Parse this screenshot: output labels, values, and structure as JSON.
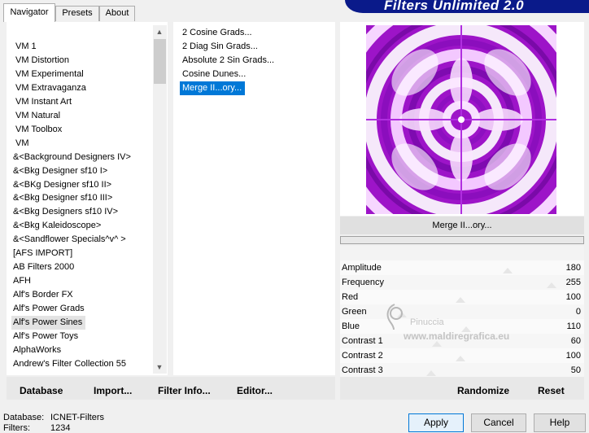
{
  "tabs": [
    "Navigator",
    "Presets",
    "About"
  ],
  "banner_title": "Filters Unlimited 2.0",
  "categories": [
    "VM 1",
    "VM Distortion",
    "VM Experimental",
    "VM Extravaganza",
    "VM Instant Art",
    "VM Natural",
    "VM Toolbox",
    "VM",
    "&<Background Designers IV>",
    "&<Bkg Designer sf10 I>",
    "&<BKg Designer sf10 II>",
    "&<Bkg Designer sf10 III>",
    "&<Bkg Designers sf10 IV>",
    "&<Bkg Kaleidoscope>",
    "&<Sandflower Specials^v^ >",
    "[AFS IMPORT]",
    "AB Filters 2000",
    "AFH",
    "Alf's Border FX",
    "Alf's Power Grads",
    "Alf's Power Sines",
    "Alf's Power Toys",
    "AlphaWorks",
    "Andrew's Filter Collection 55"
  ],
  "filters": [
    "2 Cosine Grads...",
    "2 Diag Sin Grads...",
    "Absolute 2 Sin Grads...",
    "Cosine Dunes...",
    "Merge II...ory..."
  ],
  "preview_caption": "Merge II...ory...",
  "params": [
    {
      "label": "Amplitude",
      "value": "180",
      "level": 0.706
    },
    {
      "label": "Frequency",
      "value": "255",
      "level": 1.0
    },
    {
      "label": "Red",
      "value": "100",
      "level": 0.392
    },
    {
      "label": "Green",
      "value": "0",
      "level": 0.0
    },
    {
      "label": "Blue",
      "value": "110",
      "level": 0.431
    },
    {
      "label": "Contrast 1",
      "value": "60",
      "level": 0.235
    },
    {
      "label": "Contrast 2",
      "value": "100",
      "level": 0.392
    },
    {
      "label": "Contrast 3",
      "value": "50",
      "level": 0.196
    }
  ],
  "watermark": {
    "line1": "Pinuccia",
    "line2": "www.maldiregrafica.eu"
  },
  "bottom_left_buttons": {
    "database": "Database",
    "import": "Import...",
    "filter_info": "Filter Info...",
    "editor": "Editor..."
  },
  "right_buttons": {
    "randomize": "Randomize",
    "reset": "Reset"
  },
  "status": {
    "database_label": "Database:",
    "database_value": "ICNET-Filters",
    "filters_label": "Filters:",
    "filters_value": "1234"
  },
  "dialog_buttons": {
    "apply": "Apply",
    "cancel": "Cancel",
    "help": "Help"
  },
  "colors": {
    "accent": "#0078d7",
    "banner": "#0a1a8a",
    "preview_magenta": "#b41ee0"
  }
}
